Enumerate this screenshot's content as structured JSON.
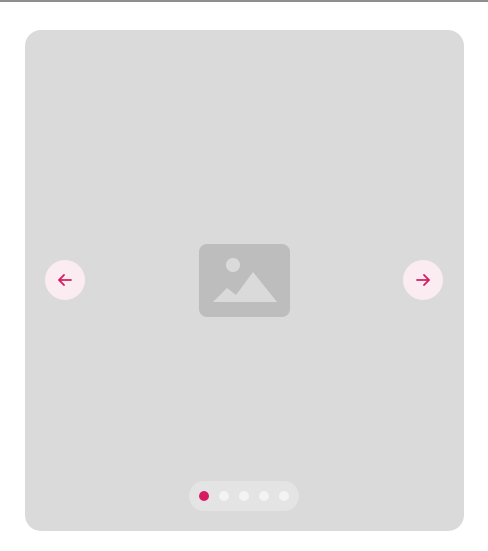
{
  "colors": {
    "accent": "#d81b60",
    "card_bg": "#dadada",
    "placeholder_bg": "#bdbdbd",
    "placeholder_fg": "#dadada",
    "nav_bg": "#fbecf2",
    "dots_track": "#e4e4e4",
    "dot_inactive": "#f3f3f3"
  },
  "carousel": {
    "slide": {
      "icon": "image-placeholder-icon"
    },
    "prev_button": {
      "icon": "arrow-left-icon"
    },
    "next_button": {
      "icon": "arrow-right-icon"
    },
    "pagination": {
      "total": 5,
      "active_index": 0
    }
  }
}
